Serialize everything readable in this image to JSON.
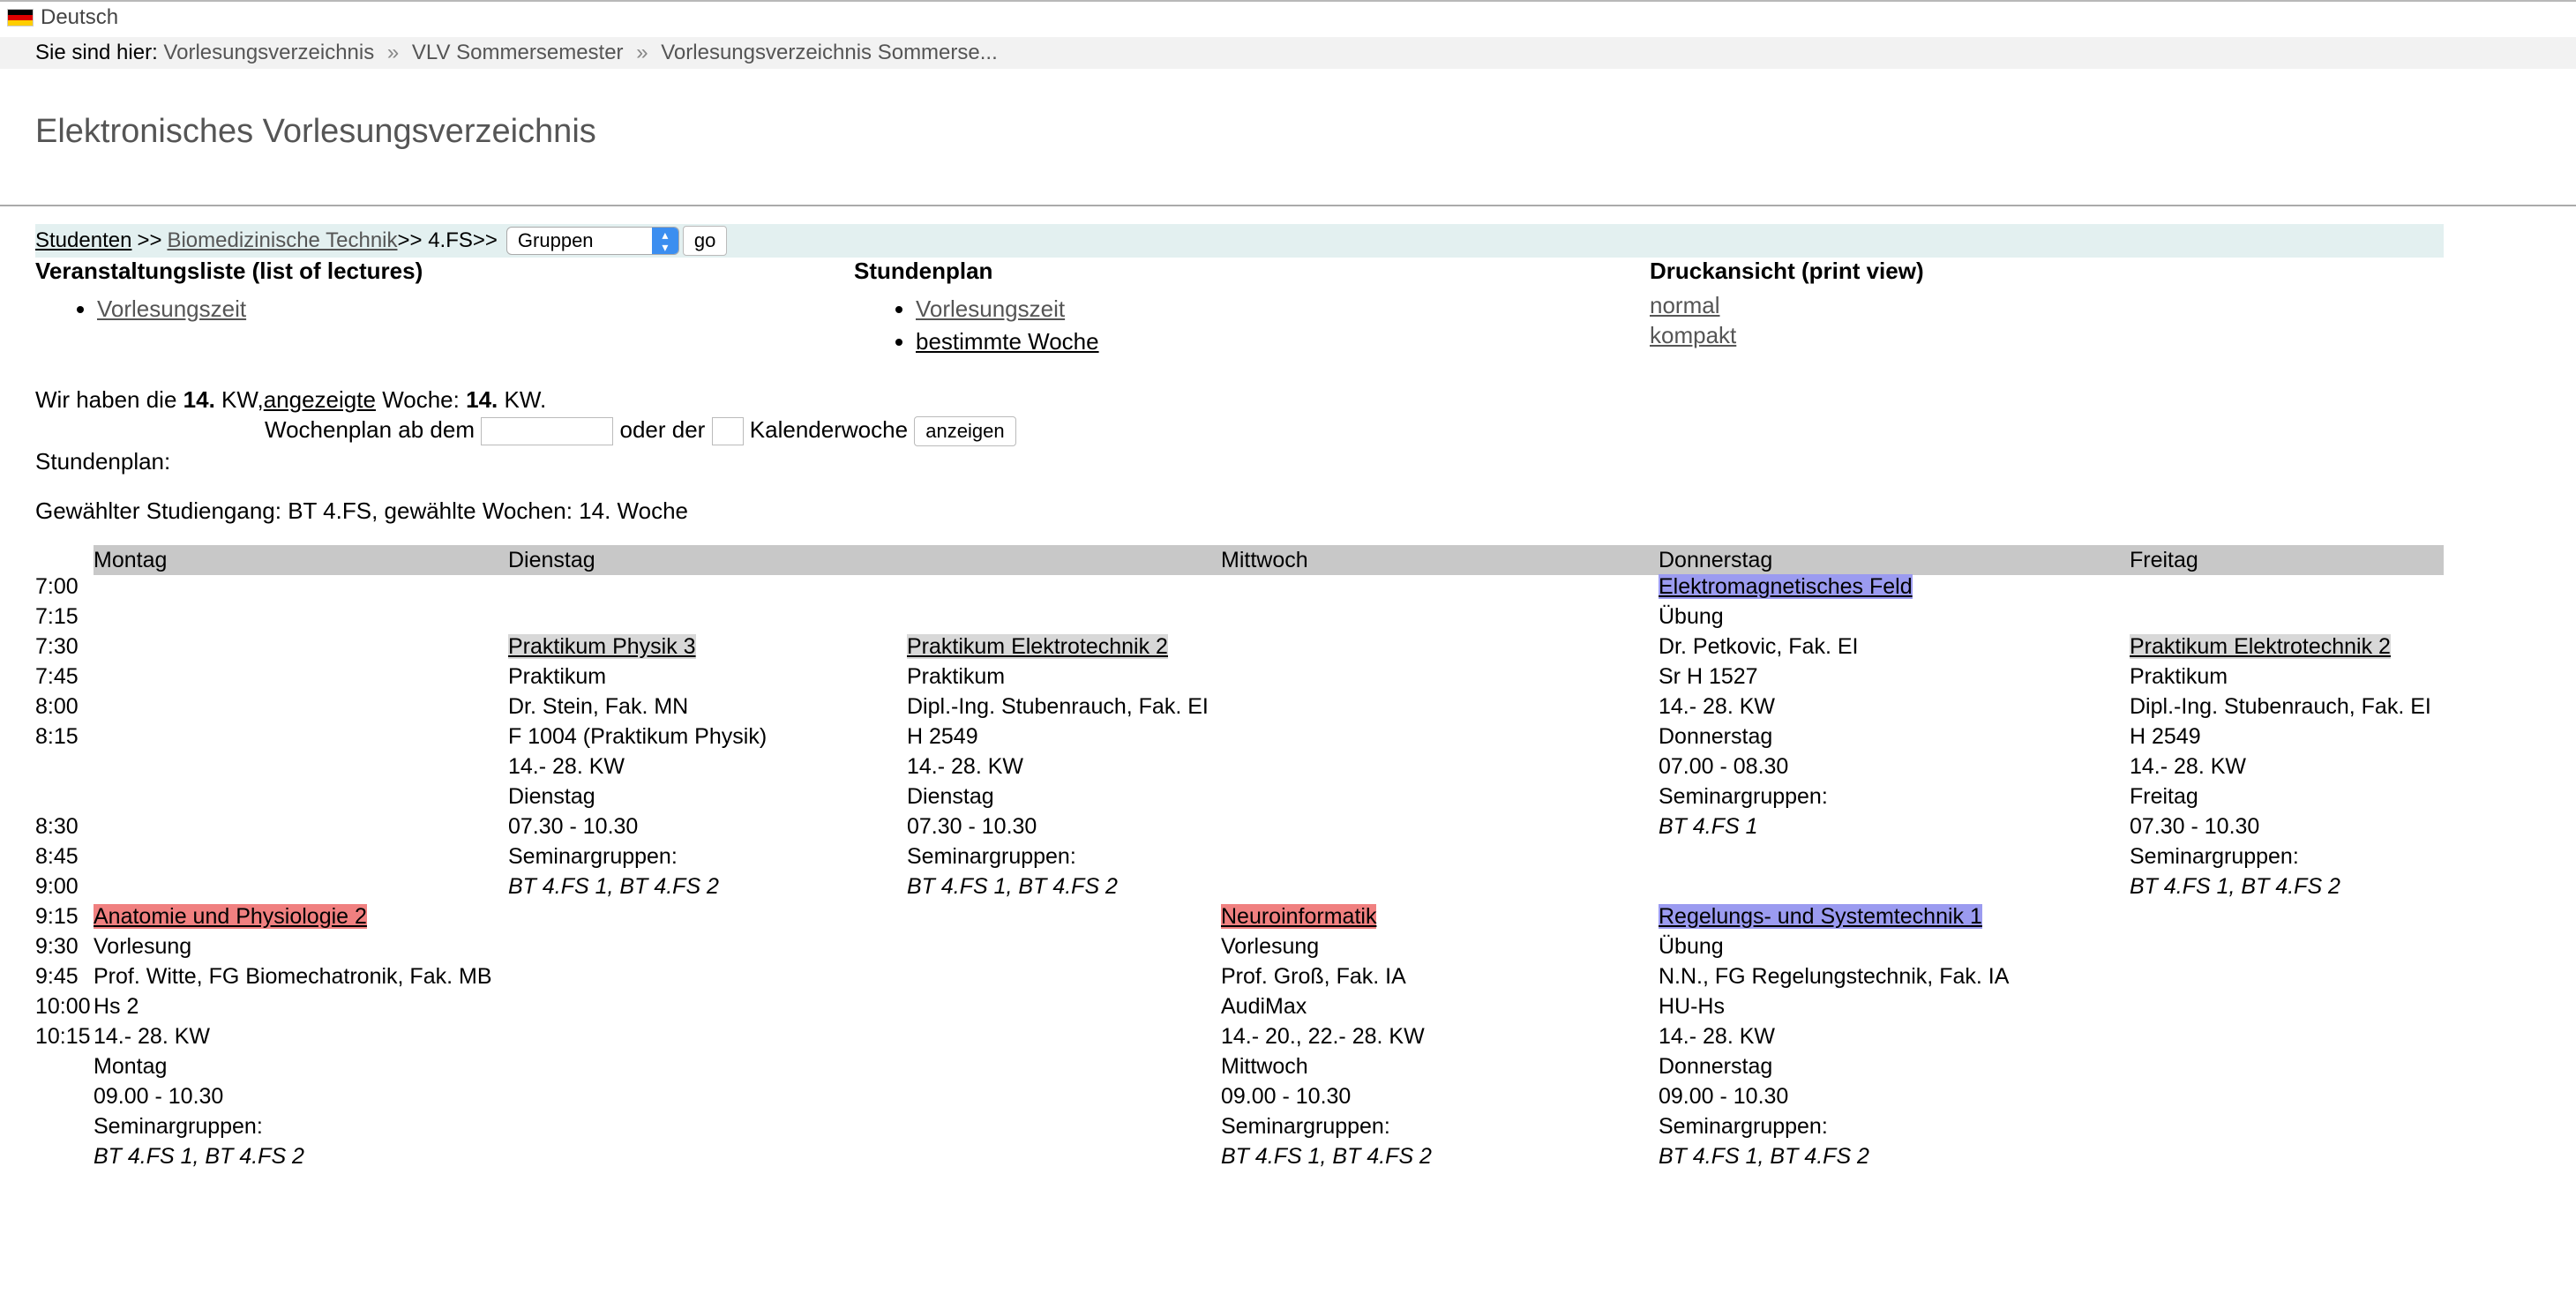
{
  "language": "Deutsch",
  "breadcrumb": {
    "prefix": "Sie sind hier:",
    "items": [
      "Vorlesungsverzeichnis",
      "VLV Sommersemester",
      "Vorlesungsverzeichnis Sommerse..."
    ],
    "separator": "»"
  },
  "page_title": "Elektronisches Vorlesungsverzeichnis",
  "nav": {
    "studenten": "Studenten",
    "sep1": ">>",
    "course": "Biomedizinische Technik",
    "sep2": ">> 4.FS>>",
    "select_value": "Gruppen",
    "go": "go"
  },
  "sections": {
    "lectures_title": "Veranstaltungsliste (list of lectures)",
    "lectures_link": "Vorlesungszeit",
    "timetable_title": "Stundenplan",
    "timetable_links": [
      "Vorlesungszeit",
      "bestimmte Woche"
    ],
    "print_title": "Druckansicht (print view)",
    "print_links": [
      "normal",
      "kompakt"
    ]
  },
  "info": {
    "line1_a": "Wir haben die",
    "kw": "14.",
    "line1_b": "KW,",
    "angezeigte": "angezeigte",
    "line1_c": "Woche:",
    "kw2": "14.",
    "line1_d": "KW.",
    "wochenplan": "Wochenplan ab dem",
    "oder": "oder der",
    "kalenderwoche": "Kalenderwoche",
    "anzeigen": "anzeigen",
    "stundenplan": "Stundenplan:",
    "gewaehlt": "Gewählter Studiengang: BT 4.FS, gewählte Wochen: 14. Woche"
  },
  "days": [
    "Montag",
    "Dienstag",
    "Mittwoch",
    "Donnerstag",
    "Freitag"
  ],
  "times": [
    "7:00",
    "7:15",
    "7:30",
    "7:45",
    "8:00",
    "8:15",
    "",
    "",
    "8:30",
    "8:45",
    "9:00",
    "9:15",
    "9:30",
    "9:45",
    "10:00",
    "10:15"
  ],
  "courses": [
    {
      "title": "Praktikum Physik 3",
      "type": "Praktikum",
      "lecturer": "Dr. Stein, Fak. MN",
      "room": "F 1004 (Praktikum Physik)",
      "weeks": "14.- 28. KW",
      "day": "Dienstag",
      "time": "07.30 - 10.30",
      "sem_label": "Seminargruppen:",
      "groups": "BT 4.FS 1, BT 4.FS 2",
      "color": "#d8d8d8"
    },
    {
      "title": "Praktikum Elektrotechnik 2",
      "type": "Praktikum",
      "lecturer": "Dipl.-Ing. Stubenrauch, Fak. EI",
      "room": "H 2549",
      "weeks": "14.- 28. KW",
      "day": "Dienstag",
      "time": "07.30 - 10.30",
      "sem_label": "Seminargruppen:",
      "groups": "BT 4.FS 1, BT 4.FS 2",
      "color": "#d8d8d8"
    },
    {
      "title": "Elektromagnetisches Feld",
      "type": "Übung",
      "lecturer": "Dr. Petkovic, Fak. EI",
      "room": "Sr H 1527",
      "weeks": "14.- 28. KW",
      "day": "Donnerstag",
      "time": "07.00 - 08.30",
      "sem_label": "Seminargruppen:",
      "groups": "BT 4.FS 1",
      "color": "#9b9bf0"
    },
    {
      "title": "Praktikum Elektrotechnik 2",
      "type": "Praktikum",
      "lecturer": "Dipl.-Ing. Stubenrauch, Fak. EI",
      "room": "H 2549",
      "weeks": "14.- 28. KW",
      "day": "Freitag",
      "time": "07.30 - 10.30",
      "sem_label": "Seminargruppen:",
      "groups": "BT 4.FS 1, BT 4.FS 2",
      "color": "#d8d8d8"
    },
    {
      "title": "Anatomie und Physiologie 2",
      "type": "Vorlesung",
      "lecturer": "Prof. Witte, FG Biomechatronik, Fak. MB",
      "room": "Hs 2",
      "weeks": "14.- 28. KW",
      "day": "Montag",
      "time": "09.00 - 10.30",
      "sem_label": "Seminargruppen:",
      "groups": "BT 4.FS 1, BT 4.FS 2",
      "color": "#f08080"
    },
    {
      "title": "Neuroinformatik",
      "type": "Vorlesung",
      "lecturer": "Prof. Groß, Fak. IA",
      "room": "AudiMax",
      "weeks": "14.- 20., 22.- 28. KW",
      "day": "Mittwoch",
      "time": "09.00 - 10.30",
      "sem_label": "Seminargruppen:",
      "groups": "BT 4.FS 1, BT 4.FS 2",
      "color": "#f08080"
    },
    {
      "title": "Regelungs- und Systemtechnik 1",
      "type": "Übung",
      "lecturer": "N.N., FG Regelungstechnik, Fak. IA",
      "room": "HU-Hs",
      "weeks": "14.- 28. KW",
      "day": "Donnerstag",
      "time": "09.00 - 10.30",
      "sem_label": "Seminargruppen:",
      "groups": "BT 4.FS 1, BT 4.FS 2",
      "color": "#9b9bf0"
    }
  ]
}
